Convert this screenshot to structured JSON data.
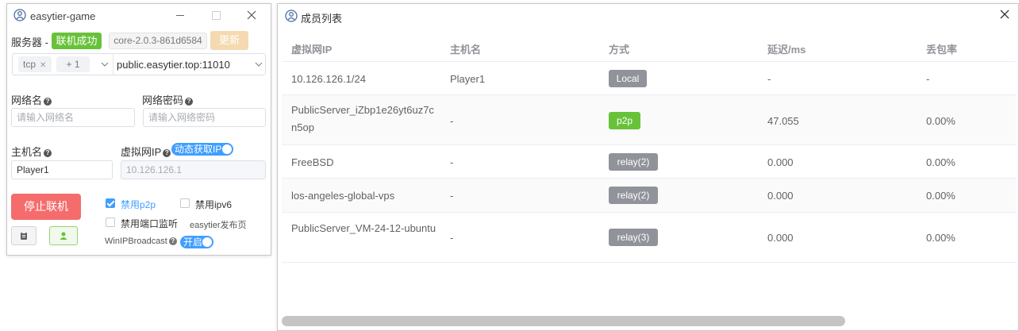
{
  "app_window": {
    "title": "easytier-game",
    "server_label": "服务器 -",
    "status_tag": "联机成功",
    "version_tag": "core-2.0.3-861d6584",
    "update_button": "更新",
    "protocol_tag": "tcp",
    "protocol_more": "+ 1",
    "server_address": "public.easytier.top:11010",
    "network_name_label": "网络名",
    "network_name_placeholder": "请输入网络名",
    "network_password_label": "网络密码",
    "network_password_placeholder": "请输入网络密码",
    "hostname_label": "主机名",
    "hostname_value": "Player1",
    "virtual_ip_label": "虚拟网IP",
    "dhcp_switch_label": "动态获取IP",
    "virtual_ip_value": "10.126.126.1",
    "stop_button": "停止联机",
    "disable_p2p_label": "禁用p2p",
    "disable_p2p_checked": true,
    "disable_ipv6_label": "禁用ipv6",
    "disable_ipv6_checked": false,
    "disable_port_monitor_label": "禁用端口监听",
    "disable_port_monitor_checked": false,
    "release_page_link": "easytier发布页",
    "winip_broadcast_label": "WinIPBroadcast",
    "winip_switch_label": "开启"
  },
  "members_window": {
    "title": "成员列表",
    "columns": [
      "虚拟网IP",
      "主机名",
      "方式",
      "延迟/ms",
      "丢包率"
    ],
    "rows": [
      {
        "ip": "10.126.126.1/24",
        "host": "Player1",
        "mode": "Local",
        "latency": "-",
        "loss": "-"
      },
      {
        "ip": "PublicServer_iZbp1e26yt6uz7cn5op",
        "host": "-",
        "mode": "p2p",
        "latency": "47.055",
        "loss": "0.00%"
      },
      {
        "ip": "FreeBSD",
        "host": "-",
        "mode": "relay(2)",
        "latency": "0.000",
        "loss": "0.00%"
      },
      {
        "ip": "los-angeles-global-vps",
        "host": "-",
        "mode": "relay(2)",
        "latency": "0.000",
        "loss": "0.00%"
      },
      {
        "ip": "PublicServer_VM-24-12-ubuntu",
        "host": "-",
        "mode": "relay(3)",
        "latency": "0.000",
        "loss": "0.00%"
      }
    ]
  }
}
